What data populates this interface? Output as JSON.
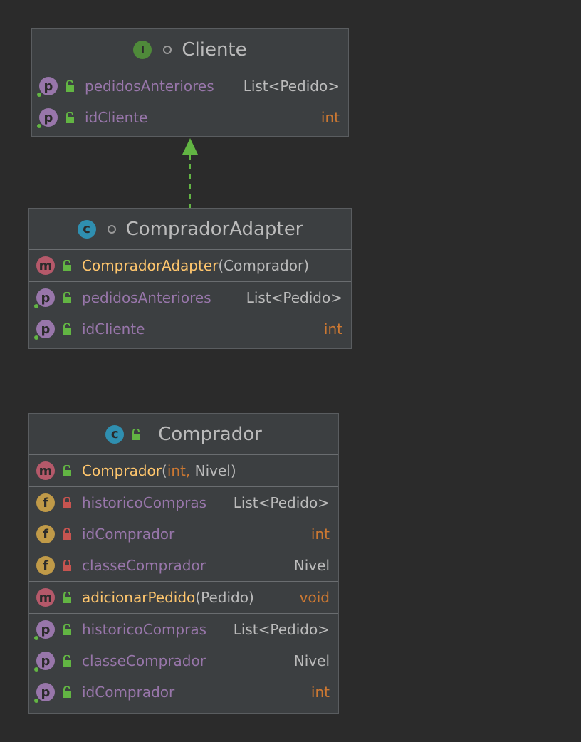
{
  "diagram": {
    "cliente": {
      "kind_badge": "I",
      "title": "Cliente",
      "properties": [
        {
          "badge": "p",
          "name": "pedidosAnteriores",
          "type": "List<Pedido>"
        },
        {
          "badge": "p",
          "name": "idCliente",
          "type": "int"
        }
      ]
    },
    "adapter": {
      "kind_badge": "c",
      "title": "CompradorAdapter",
      "constructor": {
        "badge": "m",
        "name": "CompradorAdapter",
        "open": "(",
        "param": "Comprador",
        "close": ")"
      },
      "properties": [
        {
          "badge": "p",
          "name": "pedidosAnteriores",
          "type": "List<Pedido>"
        },
        {
          "badge": "p",
          "name": "idCliente",
          "type": "int"
        }
      ]
    },
    "comprador": {
      "kind_badge": "c",
      "title": "Comprador",
      "constructor": {
        "badge": "m",
        "name": "Comprador",
        "open": "(",
        "param1": "int",
        "comma": ",",
        "param2": " Nivel",
        "close": ")"
      },
      "fields": [
        {
          "badge": "f",
          "name": "historicoCompras",
          "type": "List<Pedido>"
        },
        {
          "badge": "f",
          "name": "idComprador",
          "type": "int"
        },
        {
          "badge": "f",
          "name": "classeComprador",
          "type": "Nivel"
        }
      ],
      "method": {
        "badge": "m",
        "name": "adicionarPedido",
        "open": "(",
        "param": "Pedido",
        "close": ")",
        "return": "void"
      },
      "properties": [
        {
          "badge": "p",
          "name": "historicoCompras",
          "type": "List<Pedido>"
        },
        {
          "badge": "p",
          "name": "classeComprador",
          "type": "Nivel"
        },
        {
          "badge": "p",
          "name": "idComprador",
          "type": "int"
        }
      ]
    },
    "colors": {
      "background": "#2b2b2b",
      "box": "#3c3f41",
      "property": "#9876aa",
      "method": "#ffc66d",
      "primitive": "#cc7832",
      "arrow": "#62b543"
    },
    "icons": {
      "open_lock": "unlocked-lock-icon",
      "closed_lock": "locked-lock-icon",
      "visibility": "package-visibility-icon"
    }
  }
}
